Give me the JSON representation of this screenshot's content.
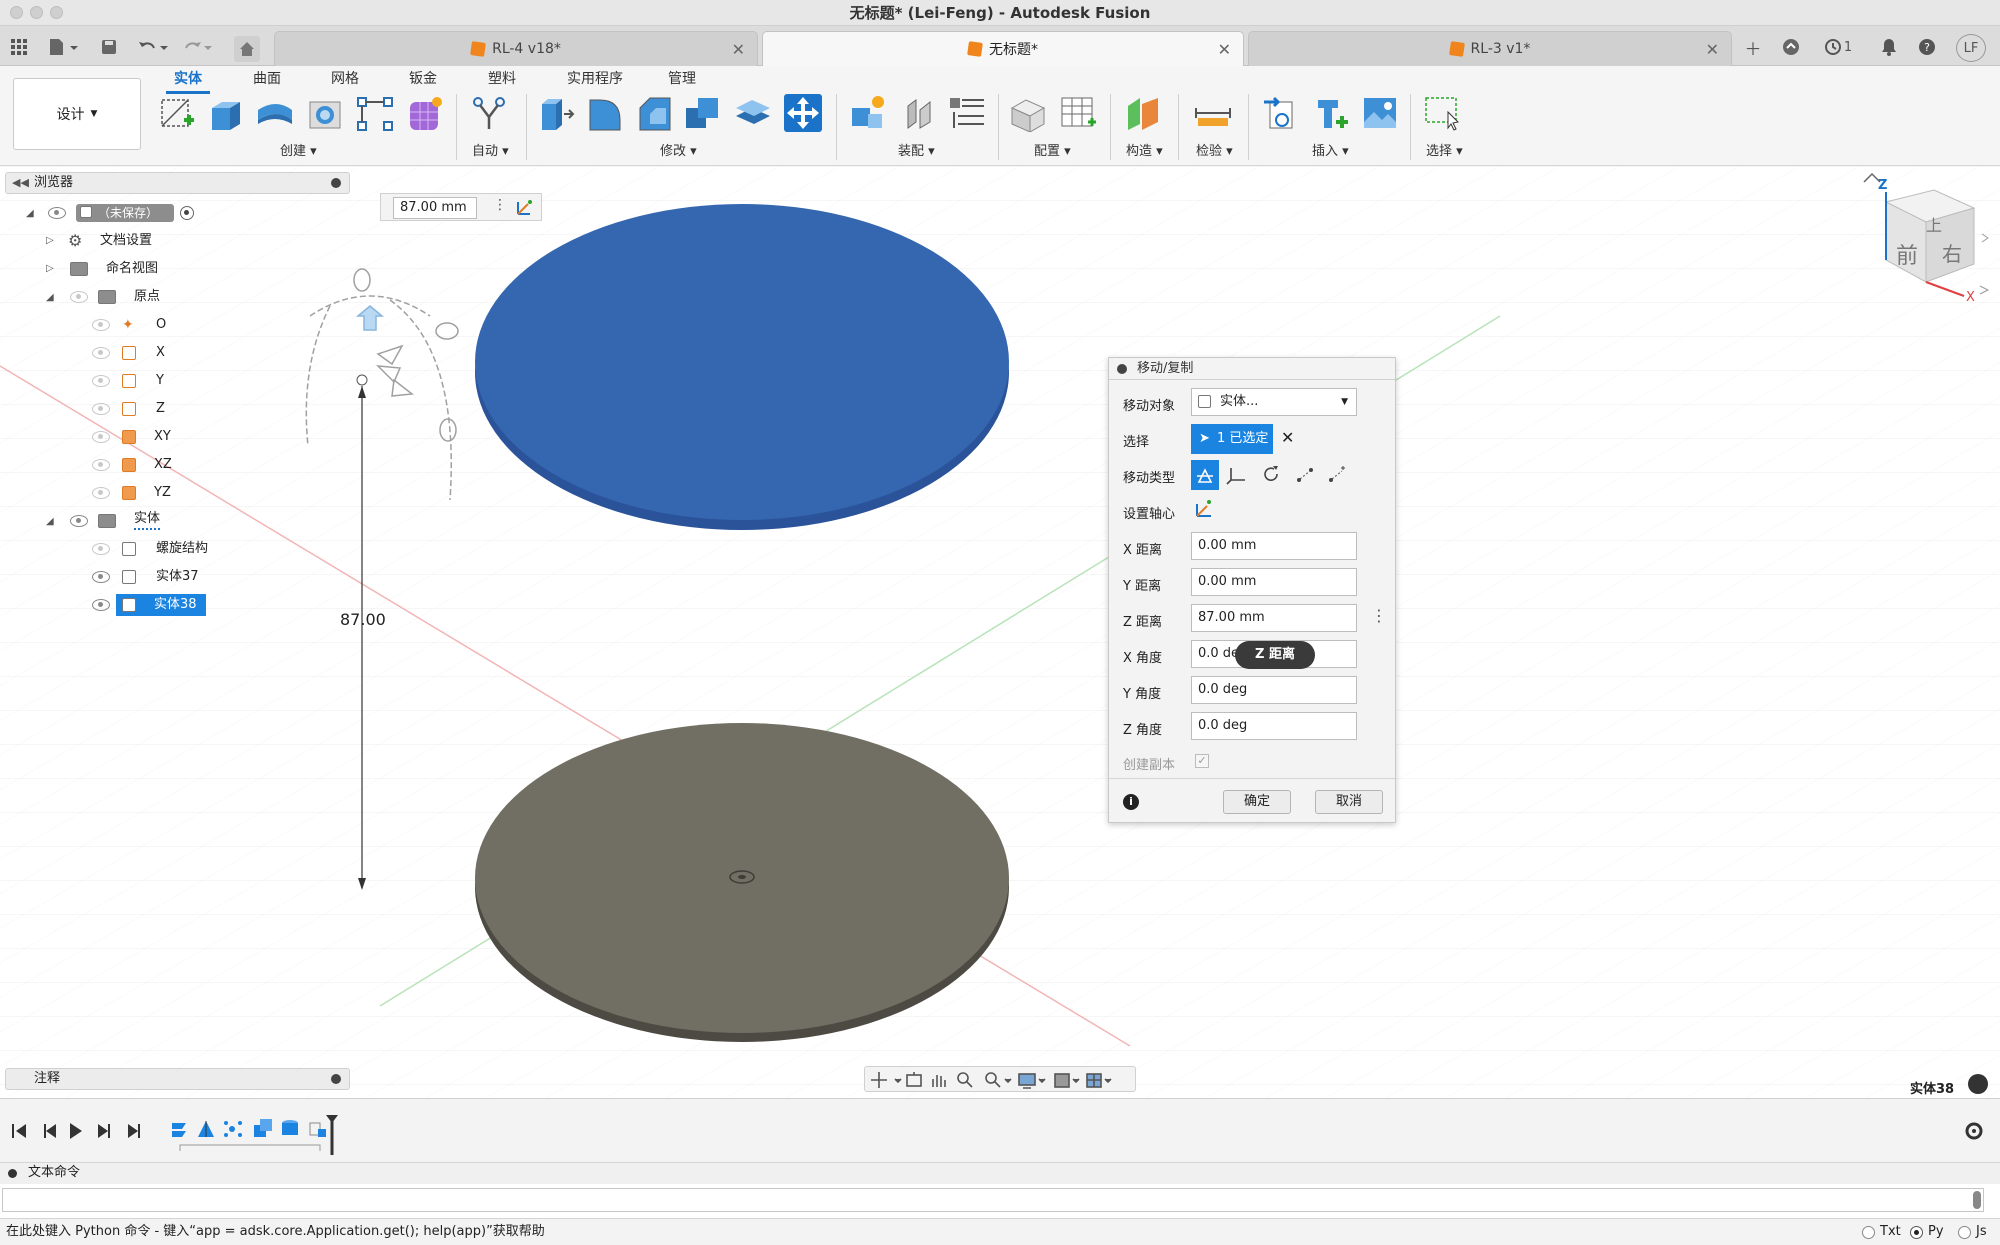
{
  "window": {
    "title": "无标题* (Lei-Feng) - Autodesk Fusion"
  },
  "tabs": [
    {
      "label": "RL-4 v18*"
    },
    {
      "label": "无标题*"
    },
    {
      "label": "RL-3 v1*"
    }
  ],
  "tabbar": {
    "job_count": "1",
    "user_initials": "LF"
  },
  "ribbon": {
    "design_label": "设计",
    "tabs": [
      "实体",
      "曲面",
      "网格",
      "钣金",
      "塑料",
      "实用程序",
      "管理"
    ],
    "groups": [
      "创建",
      "自动",
      "修改",
      "装配",
      "配置",
      "构造",
      "检验",
      "插入",
      "选择"
    ]
  },
  "measure_box": {
    "value": "87.00 mm"
  },
  "viewcube": {
    "top": "上",
    "front": "前",
    "right": "右",
    "axis_z": "Z",
    "axis_x": "X"
  },
  "browser": {
    "title": "浏览器",
    "root": "（未保存）",
    "items": {
      "doc_settings": "文档设置",
      "named_views": "命名视图",
      "origin": "原点",
      "o": "O",
      "x": "X",
      "y": "Y",
      "z": "Z",
      "xy": "XY",
      "xz": "XZ",
      "yz": "YZ",
      "bodies": "实体",
      "helix": "螺旋结构",
      "body37": "实体37",
      "body38": "实体38"
    }
  },
  "annotation": {
    "dimension": "87.00"
  },
  "dialog": {
    "title": "移动/复制",
    "move_object_label": "移动对象",
    "move_object_value": "实体...",
    "selection_label": "选择",
    "selection_value": "1 已选定",
    "move_type_label": "移动类型",
    "pivot_label": "设置轴心",
    "x_dist_label": "X 距离",
    "x_dist": "0.00 mm",
    "y_dist_label": "Y 距离",
    "y_dist": "0.00 mm",
    "z_dist_label": "Z 距离",
    "z_dist": "87.00 mm",
    "x_angle_label": "X 角度",
    "x_angle": "0.0 deg",
    "y_angle_label": "Y 角度",
    "y_angle": "0.0 deg",
    "z_angle_label": "Z 角度",
    "z_angle": "0.0 deg",
    "copy_label": "创建副本",
    "ok": "确定",
    "cancel": "取消",
    "tooltip": "Z 距离"
  },
  "notes": {
    "title": "注释"
  },
  "selected_body": "实体38",
  "textcmd": {
    "title": "文本命令",
    "hint": "在此处键入 Python 命令 - 键入“app = adsk.core.Application.get(); help(app)”获取帮助",
    "opt_txt": "Txt",
    "opt_py": "Py",
    "opt_js": "Js"
  },
  "colors": {
    "accent": "#1a73c8",
    "disk_top": "#3566b0",
    "disk_bottom": "#716e63"
  }
}
